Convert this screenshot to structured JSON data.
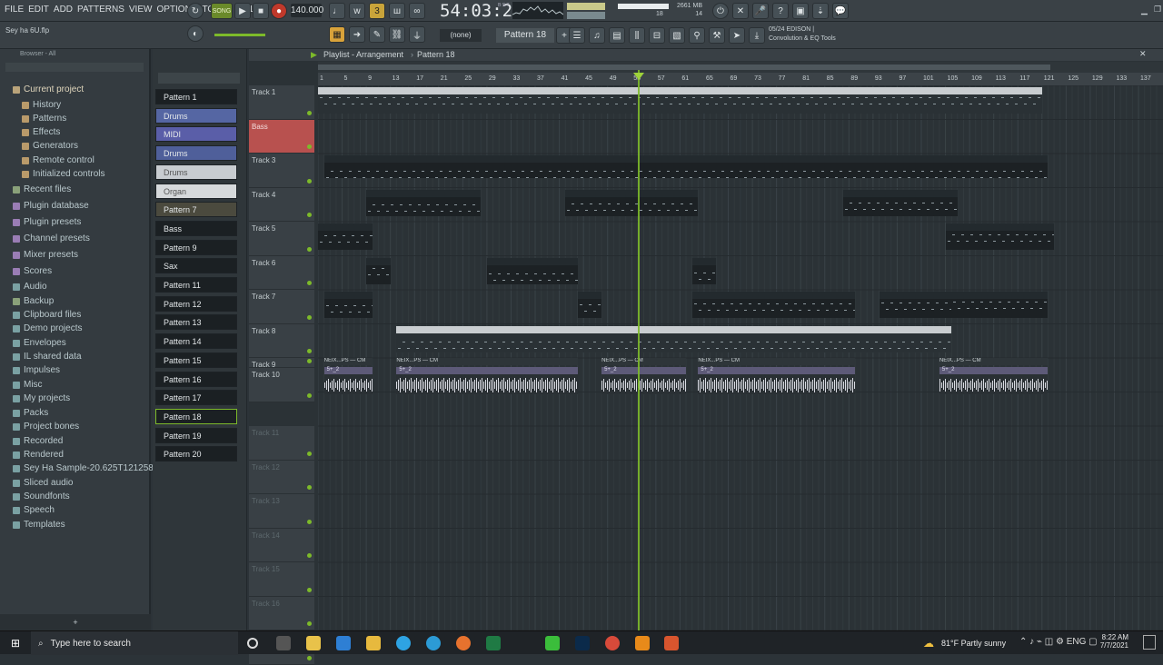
{
  "menu": [
    "FILE",
    "EDIT",
    "ADD",
    "PATTERNS",
    "VIEW",
    "OPTIONS",
    "TOOLS",
    "HELP"
  ],
  "transport": {
    "mode": "SONG",
    "tempo": "140.000",
    "time": "54:03:20",
    "time_sub": "B:S:T"
  },
  "cpu": {
    "mem": "2661 MB",
    "voices": "18",
    "poly": "14"
  },
  "project_file": "Sey ha 6U.flp",
  "pattern_selector": {
    "snap": "(none)",
    "pattern": "Pattern 18"
  },
  "hint": {
    "line1": "05/24  EDISON |",
    "line2": "Convolution & EQ Tools"
  },
  "browser": {
    "title": "Browser - All",
    "items": [
      {
        "label": "Current project",
        "color": "#b9a37a"
      },
      {
        "label": "History",
        "color": "#b99a6a"
      },
      {
        "label": "Patterns",
        "color": "#b99a6a"
      },
      {
        "label": "Effects",
        "color": "#b99a6a"
      },
      {
        "label": "Generators",
        "color": "#b99a6a"
      },
      {
        "label": "Remote control",
        "color": "#b99a6a"
      },
      {
        "label": "Initialized controls",
        "color": "#b99a6a"
      },
      {
        "label": "Recent files",
        "color": "#8aa17a"
      },
      {
        "label": "Plugin database",
        "color": "#9a7db5"
      },
      {
        "label": "Plugin presets",
        "color": "#9a7db5"
      },
      {
        "label": "Channel presets",
        "color": "#9a7db5"
      },
      {
        "label": "Mixer presets",
        "color": "#9a7db5"
      },
      {
        "label": "Scores",
        "color": "#9a7db5"
      },
      {
        "label": "Audio",
        "color": "#7aa1a3"
      },
      {
        "label": "Backup",
        "color": "#8aa17a"
      },
      {
        "label": "Clipboard files",
        "color": "#7aa1a3"
      },
      {
        "label": "Demo projects",
        "color": "#7aa1a3"
      },
      {
        "label": "Envelopes",
        "color": "#7aa1a3"
      },
      {
        "label": "IL shared data",
        "color": "#7aa1a3"
      },
      {
        "label": "Impulses",
        "color": "#7aa1a3"
      },
      {
        "label": "Misc",
        "color": "#7aa1a3"
      },
      {
        "label": "My projects",
        "color": "#7aa1a3"
      },
      {
        "label": "Packs",
        "color": "#7aa1a3"
      },
      {
        "label": "Project bones",
        "color": "#7aa1a3"
      },
      {
        "label": "Recorded",
        "color": "#7aa1a3"
      },
      {
        "label": "Rendered",
        "color": "#7aa1a3"
      },
      {
        "label": "Sey Ha Sample-20.625T121258Z-001",
        "color": "#7aa1a3"
      },
      {
        "label": "Sliced audio",
        "color": "#7aa1a3"
      },
      {
        "label": "Soundfonts",
        "color": "#7aa1a3"
      },
      {
        "label": "Speech",
        "color": "#7aa1a3"
      },
      {
        "label": "Templates",
        "color": "#7aa1a3"
      }
    ]
  },
  "patterns": [
    {
      "label": "Pattern 1",
      "bg": "#1b2023"
    },
    {
      "label": "Drums",
      "bg": "#5566a3"
    },
    {
      "label": "MIDI",
      "bg": "#5a5ea8"
    },
    {
      "label": "Drums",
      "bg": "#4f5f9a"
    },
    {
      "label": "Drums",
      "bg": "#c8ccd0"
    },
    {
      "label": "Organ",
      "bg": "#d6d9db"
    },
    {
      "label": "Pattern 7",
      "bg": "#4b4a3e"
    },
    {
      "label": "Bass",
      "bg": "#1b2023"
    },
    {
      "label": "Pattern 9",
      "bg": "#1b2023"
    },
    {
      "label": "Sax",
      "bg": "#1b2023"
    },
    {
      "label": "Pattern 11",
      "bg": "#1b2023"
    },
    {
      "label": "Pattern 12",
      "bg": "#1b2023"
    },
    {
      "label": "Pattern 13",
      "bg": "#1b2023"
    },
    {
      "label": "Pattern 14",
      "bg": "#1b2023"
    },
    {
      "label": "Pattern 15",
      "bg": "#1b2023"
    },
    {
      "label": "Pattern 16",
      "bg": "#1b2023"
    },
    {
      "label": "Pattern 17",
      "bg": "#1b2023"
    },
    {
      "label": "Pattern 18",
      "bg": "#1b2023"
    },
    {
      "label": "Pattern 19",
      "bg": "#1b2023"
    },
    {
      "label": "Pattern 20",
      "bg": "#1b2023"
    }
  ],
  "playlist": {
    "title": "Playlist - Arrangement",
    "current_pattern": "Pattern 18",
    "ruler": [
      "1",
      "5",
      "9",
      "13",
      "17",
      "21",
      "25",
      "29",
      "33",
      "37",
      "41",
      "45",
      "49",
      "53",
      "57",
      "61",
      "65",
      "69",
      "73",
      "77",
      "81",
      "85",
      "89",
      "93",
      "97",
      "101",
      "105",
      "109",
      "113",
      "117",
      "121",
      "125",
      "129",
      "133",
      "137"
    ],
    "tracks": [
      "Track 1",
      "Bass",
      "Track 3",
      "Track 4",
      "Track 5",
      "Track 6",
      "Track 7",
      "Track 8",
      "Track 9",
      "Track 10",
      "Track 11",
      "Track 12",
      "Track 13",
      "Track 14",
      "Track 15",
      "Track 16",
      "Track 17"
    ]
  },
  "clips": [
    {
      "label": "Drums",
      "track": 0,
      "start": 1,
      "end": 121,
      "light": true
    },
    {
      "label": "Bass",
      "track": 2,
      "start": 2,
      "end": 122
    },
    {
      "label": "Pattern 9",
      "track": 3,
      "start": 9,
      "end": 28
    },
    {
      "label": "Pattern 12",
      "track": 3,
      "start": 42,
      "end": 64
    },
    {
      "label": "Pattern 15",
      "track": 3,
      "start": 88,
      "end": 107
    },
    {
      "label": "Pattern 7",
      "track": 4,
      "start": 1,
      "end": 10
    },
    {
      "label": "Pattern 16",
      "track": 4,
      "start": 105,
      "end": 123
    },
    {
      "label": "Pa..1",
      "track": 5,
      "start": 9,
      "end": 13
    },
    {
      "label": "Sax",
      "track": 5,
      "start": 29,
      "end": 44
    },
    {
      "label": "Pa..1",
      "track": 5,
      "start": 63,
      "end": 67
    },
    {
      "label": "Pattern 17",
      "track": 6,
      "start": 2,
      "end": 10
    },
    {
      "label": "Pa..3",
      "track": 6,
      "start": 44,
      "end": 48
    },
    {
      "label": "Pattern 14",
      "track": 6,
      "start": 63,
      "end": 90
    },
    {
      "label": "Pattern 19",
      "track": 6,
      "start": 94,
      "end": 106
    },
    {
      "label": "Pattern 18",
      "track": 6,
      "start": 106,
      "end": 122
    },
    {
      "label": "Organ",
      "track": 7,
      "start": 14,
      "end": 106,
      "light": true
    }
  ],
  "track9_label": "NEIX...PS — CM",
  "track10_label": "5+_2",
  "taskbar": {
    "search": "Type here to search",
    "weather": "81°F  Partly sunny",
    "time": "8:22 AM",
    "date": "7/7/2021"
  }
}
